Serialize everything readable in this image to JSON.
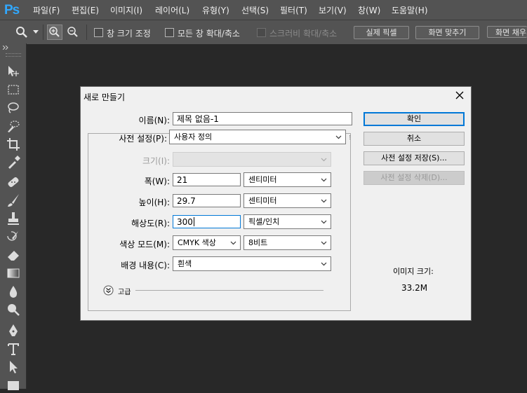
{
  "app": {
    "logo": "Ps"
  },
  "menu": [
    {
      "label": "파일(F)"
    },
    {
      "label": "편집(E)"
    },
    {
      "label": "이미지(I)"
    },
    {
      "label": "레이어(L)"
    },
    {
      "label": "유형(Y)"
    },
    {
      "label": "선택(S)"
    },
    {
      "label": "필터(T)"
    },
    {
      "label": "보기(V)"
    },
    {
      "label": "창(W)"
    },
    {
      "label": "도움말(H)"
    }
  ],
  "options": {
    "resize_window": "창 크기 조정",
    "zoom_all_windows": "모든 창 확대/축소",
    "scrubby_zoom": "스크러비 확대/축소",
    "actual_pixels": "실제 픽셀",
    "fit_screen": "화면 맞추기",
    "fill_screen": "화면 채우기"
  },
  "dialog": {
    "title": "새로 만들기",
    "name_label": "이름(N):",
    "name_value": "제목 없음-1",
    "preset_label": "사전 설정(P):",
    "preset_value": "사용자 정의",
    "size_label": "크기(I):",
    "width_label": "폭(W):",
    "width_value": "21",
    "width_unit": "센티미터",
    "height_label": "높이(H):",
    "height_value": "29.7",
    "height_unit": "센티미터",
    "resolution_label": "해상도(R):",
    "resolution_value": "300",
    "resolution_unit": "픽셀/인치",
    "color_mode_label": "색상 모드(M):",
    "color_mode_value": "CMYK 색상",
    "bit_depth_value": "8비트",
    "background_label": "배경 내용(C):",
    "background_value": "흰색",
    "advanced_label": "고급",
    "ok_button": "확인",
    "cancel_button": "취소",
    "save_preset_button": "사전 설정 저장(S)...",
    "delete_preset_button": "사전 설정 삭제(D)...",
    "image_size_label": "이미지 크기:",
    "image_size_value": "33.2M"
  },
  "colors": {
    "ps_blue": "#31a8ff",
    "focus_blue": "#0078d7",
    "ui_gray": "#535353",
    "canvas": "#282828"
  }
}
